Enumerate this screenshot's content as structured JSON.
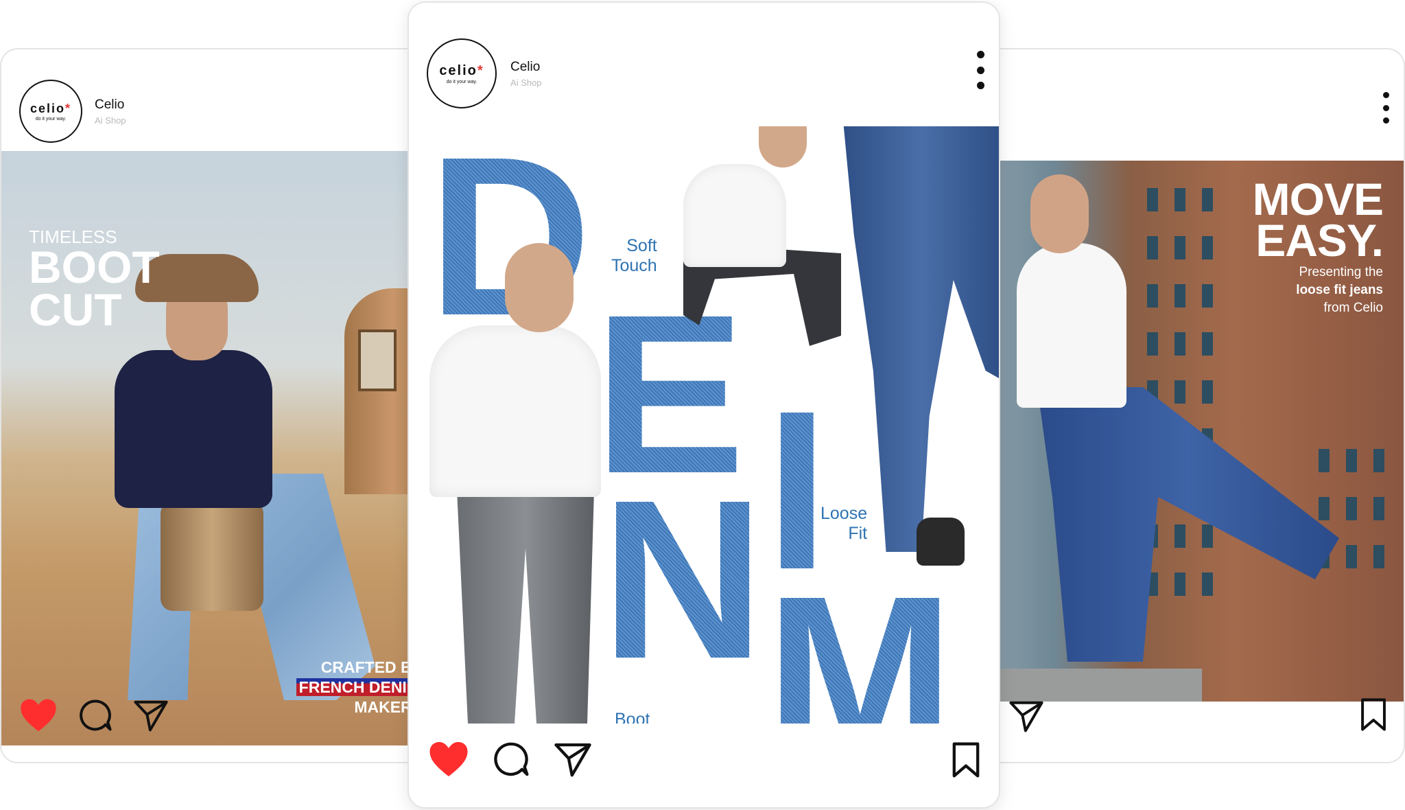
{
  "posts": [
    {
      "account": {
        "logo_text": "celio",
        "logo_star": "*",
        "logo_tagline": "do it your way.",
        "name": "Celio",
        "subtitle": "Ai Shop"
      },
      "headline_small": "TIMELESS",
      "headline_big_line1": "BOOT",
      "headline_big_line2": "CUT",
      "credit_line1": "CRAFTED BY",
      "credit_line2": "FRENCH DENIM",
      "credit_line3": "MAKERS",
      "liked": true,
      "actions": [
        "heart-icon",
        "comment-icon",
        "share-icon"
      ]
    },
    {
      "account": {
        "logo_text": "celio",
        "logo_star": "*",
        "logo_tagline": "do it your way.",
        "name": "Celio",
        "subtitle": "Ai Shop"
      },
      "letters": [
        "D",
        "E",
        "N",
        "I",
        "M"
      ],
      "caption_soft_1": "Soft",
      "caption_soft_2": "Touch",
      "caption_loose_1": "Loose",
      "caption_loose_2": "Fit",
      "caption_boot": "Boot",
      "liked": true,
      "actions": [
        "heart-icon",
        "comment-icon",
        "share-icon",
        "bookmark-icon"
      ]
    },
    {
      "headline_line1": "MOVE",
      "headline_line2": "EASY.",
      "sub_line1": "Presenting the",
      "sub_line2": "loose fit jeans",
      "sub_line3": "from Celio",
      "actions": [
        "share-icon",
        "bookmark-icon"
      ]
    }
  ],
  "colors": {
    "heart": "#ff2e2e",
    "caption": "#2e73b2",
    "denim": "#4a82c0"
  }
}
